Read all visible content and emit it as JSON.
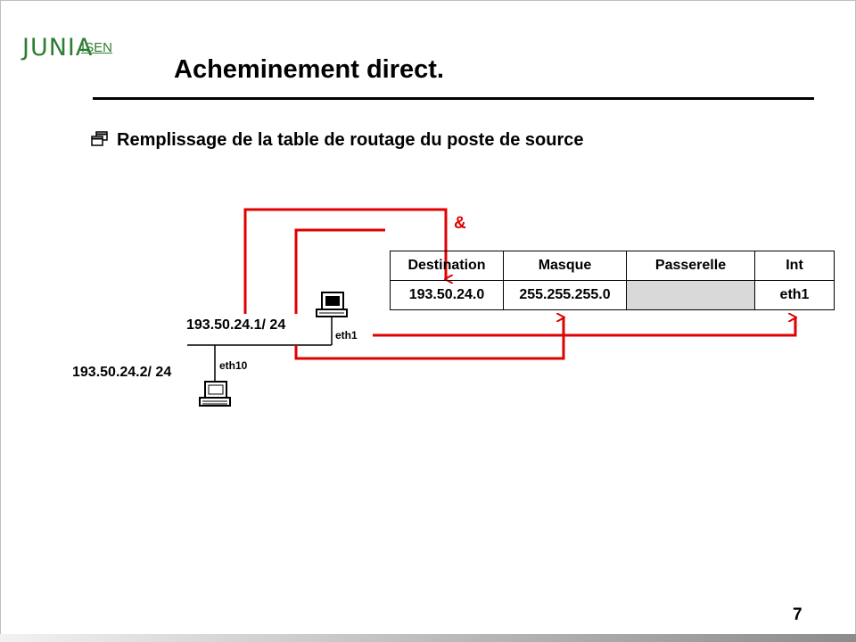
{
  "logo": {
    "brand": "JUNIA",
    "sub": "ISEN"
  },
  "slide": {
    "title": "Acheminement direct.",
    "bullet": "Remplissage de la table de routage du poste de source",
    "page_number": "7"
  },
  "diagram": {
    "ip_source": "193.50.24.1/ 24",
    "ip_dest": "193.50.24.2/ 24",
    "if_source": "eth1",
    "if_dest": "eth10",
    "annotation": "&",
    "colors": {
      "arrow": "#e00000",
      "cell_fill": "#d9d9d9"
    }
  },
  "routing_table": {
    "headers": [
      "Destination",
      "Masque",
      "Passerelle",
      "Int"
    ],
    "rows": [
      {
        "destination": "193.50.24.0",
        "mask": "255.255.255.0",
        "gateway": "",
        "interface": "eth1"
      }
    ]
  }
}
